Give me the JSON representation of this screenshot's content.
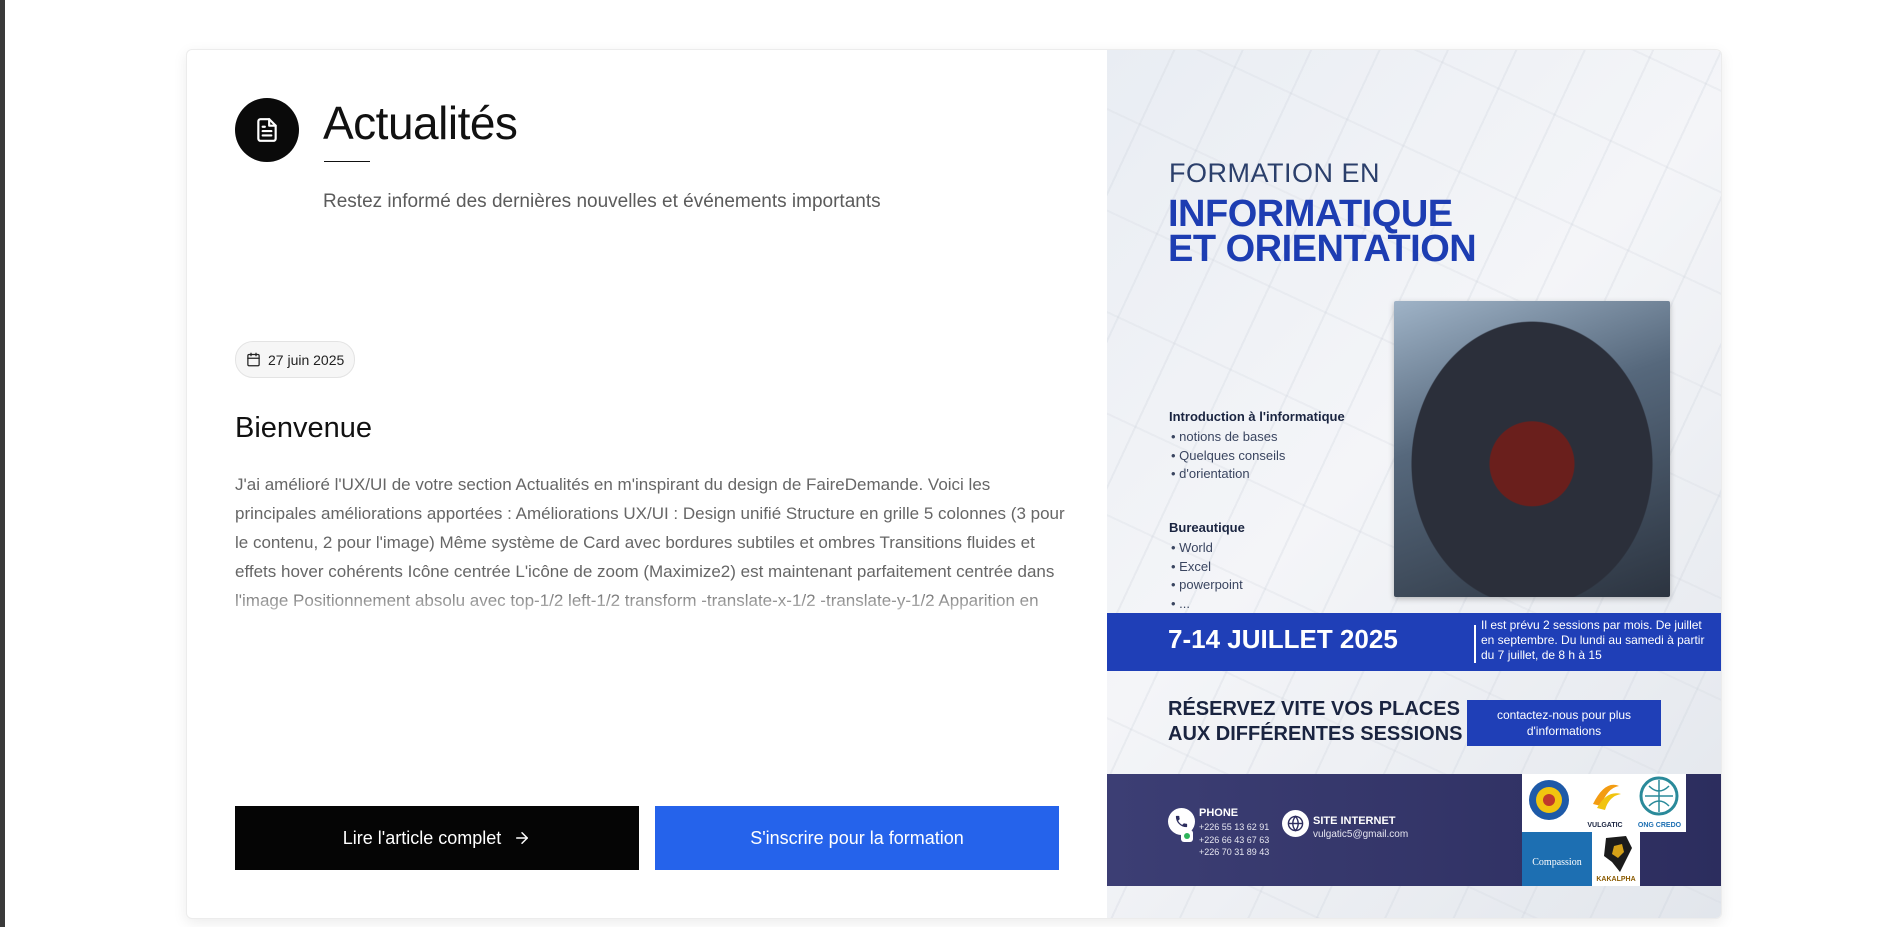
{
  "section": {
    "title": "Actualités",
    "subtitle": "Restez informé des dernières nouvelles et événements importants",
    "icon": "document-icon"
  },
  "article": {
    "date": "27 juin 2025",
    "title": "Bienvenue",
    "body": "J'ai amélioré l'UX/UI de votre section Actualités en m'inspirant du design de FaireDemande. Voici les principales améliorations apportées : Améliorations UX/UI : Design unifié Structure en grille 5 colonnes (3 pour le contenu, 2 pour l'image) Même système de Card avec bordures subtiles et ombres Transitions fluides et effets hover cohérents Icône centrée L'icône de zoom (Maximize2) est maintenant parfaitement centrée dans l'image Positionnement absolu avec top-1/2 left-1/2 transform -translate-x-1/2 -translate-y-1/2 Apparition en douceur au hover Layout responsive Image visible à la fois sur mobile et desktop Aspect ratio...",
    "read_more_label": "Lire l'article complet",
    "register_label": "S'inscrire pour la formation"
  },
  "poster": {
    "kicker": "FORMATION EN",
    "heading_line1": "INFORMATIQUE",
    "heading_line2": "ET ORIENTATION",
    "section1_title": "Introduction à l'informatique",
    "section1_items": [
      "notions de bases",
      "Quelques conseils",
      "d'orientation"
    ],
    "section2_title": "Bureautique",
    "section2_items": [
      "World",
      "Excel",
      "powerpoint",
      "..."
    ],
    "dates": "7-14 JUILLET 2025",
    "dates_note": "Il est prévu 2 sessions par mois. De juillet en septembre. Du lundi au samedi à partir du 7 juillet, de 8 h à 15",
    "reserve_line1": "RÉSERVEZ VITE VOS PLACES",
    "reserve_line2": "AUX DIFFÉRENTES SESSIONS",
    "contact_cta": "contactez-nous pour plus d'informations",
    "phone_label": "PHONE",
    "phones": [
      "+226 55 13 62 91",
      "+226 66 43 67 63",
      "+226 70 31 89 43"
    ],
    "site_label": "SITE INTERNET",
    "site_email": "vulgatic5@gmail.com",
    "logos": [
      "VULGATIC",
      "ONG CREDO",
      "Compassion",
      "KAKALPHA"
    ]
  },
  "colors": {
    "primary_blue": "#2563eb",
    "poster_blue": "#1f3fb7",
    "poster_footer": "#3c3e74",
    "dark": "#050505"
  }
}
